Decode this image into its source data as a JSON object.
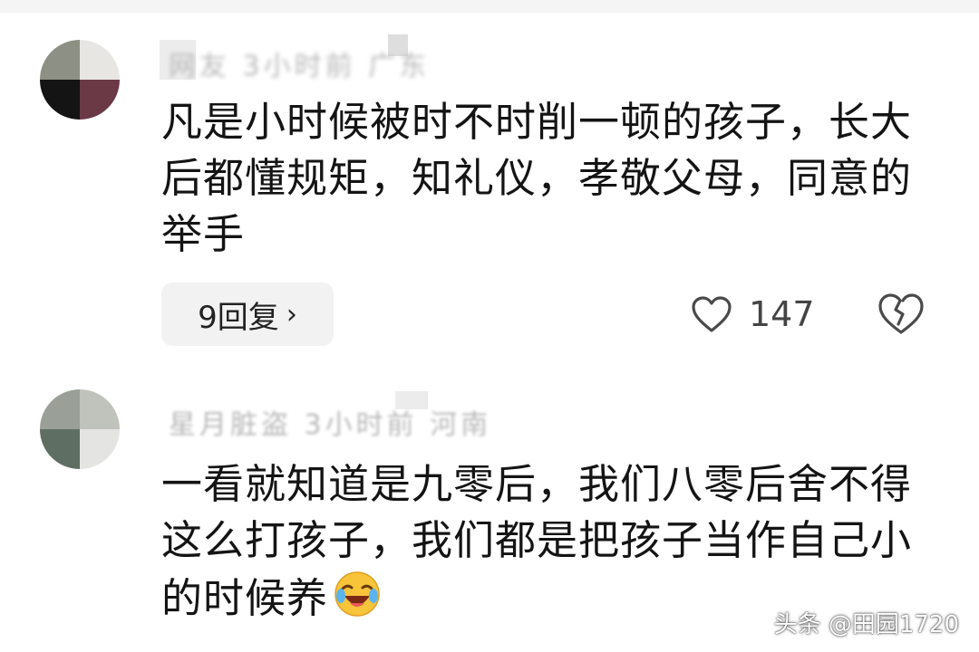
{
  "comments": [
    {
      "meta_text": "网友 3小时前 广东",
      "text": "凡是小时候被时不时削一顿的孩子，长大后都懂规矩，知礼仪，孝敬父母，同意的举手",
      "reply_label": "9回复",
      "like_count": "147",
      "avatar_colors": [
        "#8d9084",
        "#e8e6e2",
        "#141414",
        "#6a3945"
      ]
    },
    {
      "meta_text": "星月脏盗 3小时前 河南",
      "text": "一看就知道是九零后，我们八零后舍不得这么打孩子，我们都是把孩子当作自己小的时候养",
      "avatar_colors": [
        "#9aa097",
        "#bfc3bb",
        "#5f6e63",
        "#e4e5e2"
      ]
    }
  ],
  "icons": {
    "reply_chevron": "chevron-right-icon",
    "like": "heart-outline-icon",
    "dislike": "broken-heart-icon",
    "emoji": "laughing-crying-emoji"
  },
  "watermark": "头条 @田园1720"
}
